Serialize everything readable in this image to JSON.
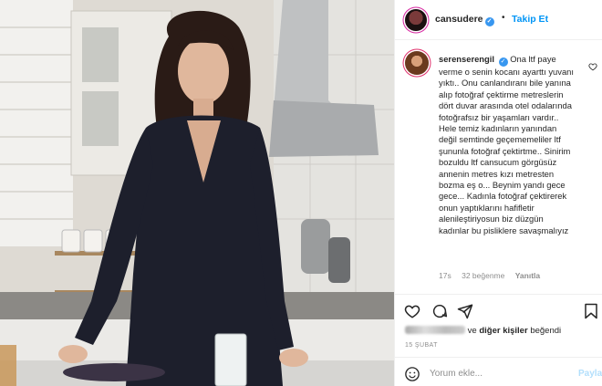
{
  "post": {
    "username": "cansudere",
    "verified": true,
    "follow_label": "Takip Et",
    "dot": "•"
  },
  "comment": {
    "username": "serenserengil",
    "text": "Ona ltf paye verme o senin kocanı ayarttı yuvanı yıktı.. Onu canlandıranı bile yanına alıp fotoğraf çektirme metreslerin dört duvar arasında otel odalarında fotoğrafsız bir yaşamları vardır.. Hele temiz kadınların yanından değil semtinde geçememeliler ltf şununla fotoğraf çektirtme.. Sinirim bozuldu ltf cansucum görgüsüz annenin metres kızı metresten bozma eş o... Beynim yandı gece gece... Kadınla fotoğraf çektirerek onun yaptıklarını hafifletir alenileştiriyosun biz düzgün kadınlar bu pisliklere savaşmalıyız",
    "time": "17s",
    "likes": "32 beğenme",
    "reply_label": "Yanıtla"
  },
  "likes_line": {
    "suffix": "diğer kişiler",
    "verb": "beğendi",
    "connector": "ve"
  },
  "date": "15 ŞUBAT",
  "add_comment": {
    "placeholder": "Yorum ekle...",
    "post_label": "Paylaş"
  },
  "icons": {
    "like": "heart-icon",
    "comment": "comment-icon",
    "share": "send-icon",
    "save": "bookmark-icon",
    "emoji": "emoji-icon"
  },
  "colors": {
    "accent": "#0095f6",
    "verified": "#3897f0",
    "muted": "#8e8e8e",
    "post_disabled": "#b2dffc"
  }
}
